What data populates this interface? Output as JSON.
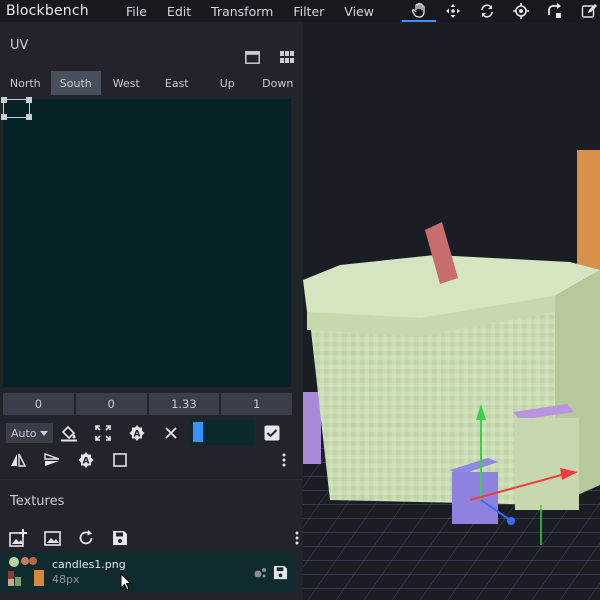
{
  "app": {
    "title": "Blockbench"
  },
  "menu": [
    "File",
    "Edit",
    "Transform",
    "Filter",
    "View"
  ],
  "tools": [
    {
      "icon": "hand-icon",
      "active": true
    },
    {
      "icon": "move-icon",
      "active": false
    },
    {
      "icon": "rotate-icon",
      "active": false
    },
    {
      "icon": "pivot-icon",
      "active": false
    },
    {
      "icon": "vertex-snap-icon",
      "active": false
    },
    {
      "icon": "edit-icon",
      "active": false
    }
  ],
  "uv": {
    "title": "UV",
    "faces": [
      "North",
      "South",
      "West",
      "East",
      "Up",
      "Down"
    ],
    "active_face": "South",
    "fields": [
      "0",
      "0",
      "1.33",
      "1"
    ],
    "auto_label": "Auto",
    "colors": {
      "canvas": "#072227",
      "accent": "#3e90ff"
    }
  },
  "textures": {
    "title": "Textures",
    "items": [
      {
        "name": "candles1.png",
        "size": "48px"
      }
    ]
  }
}
